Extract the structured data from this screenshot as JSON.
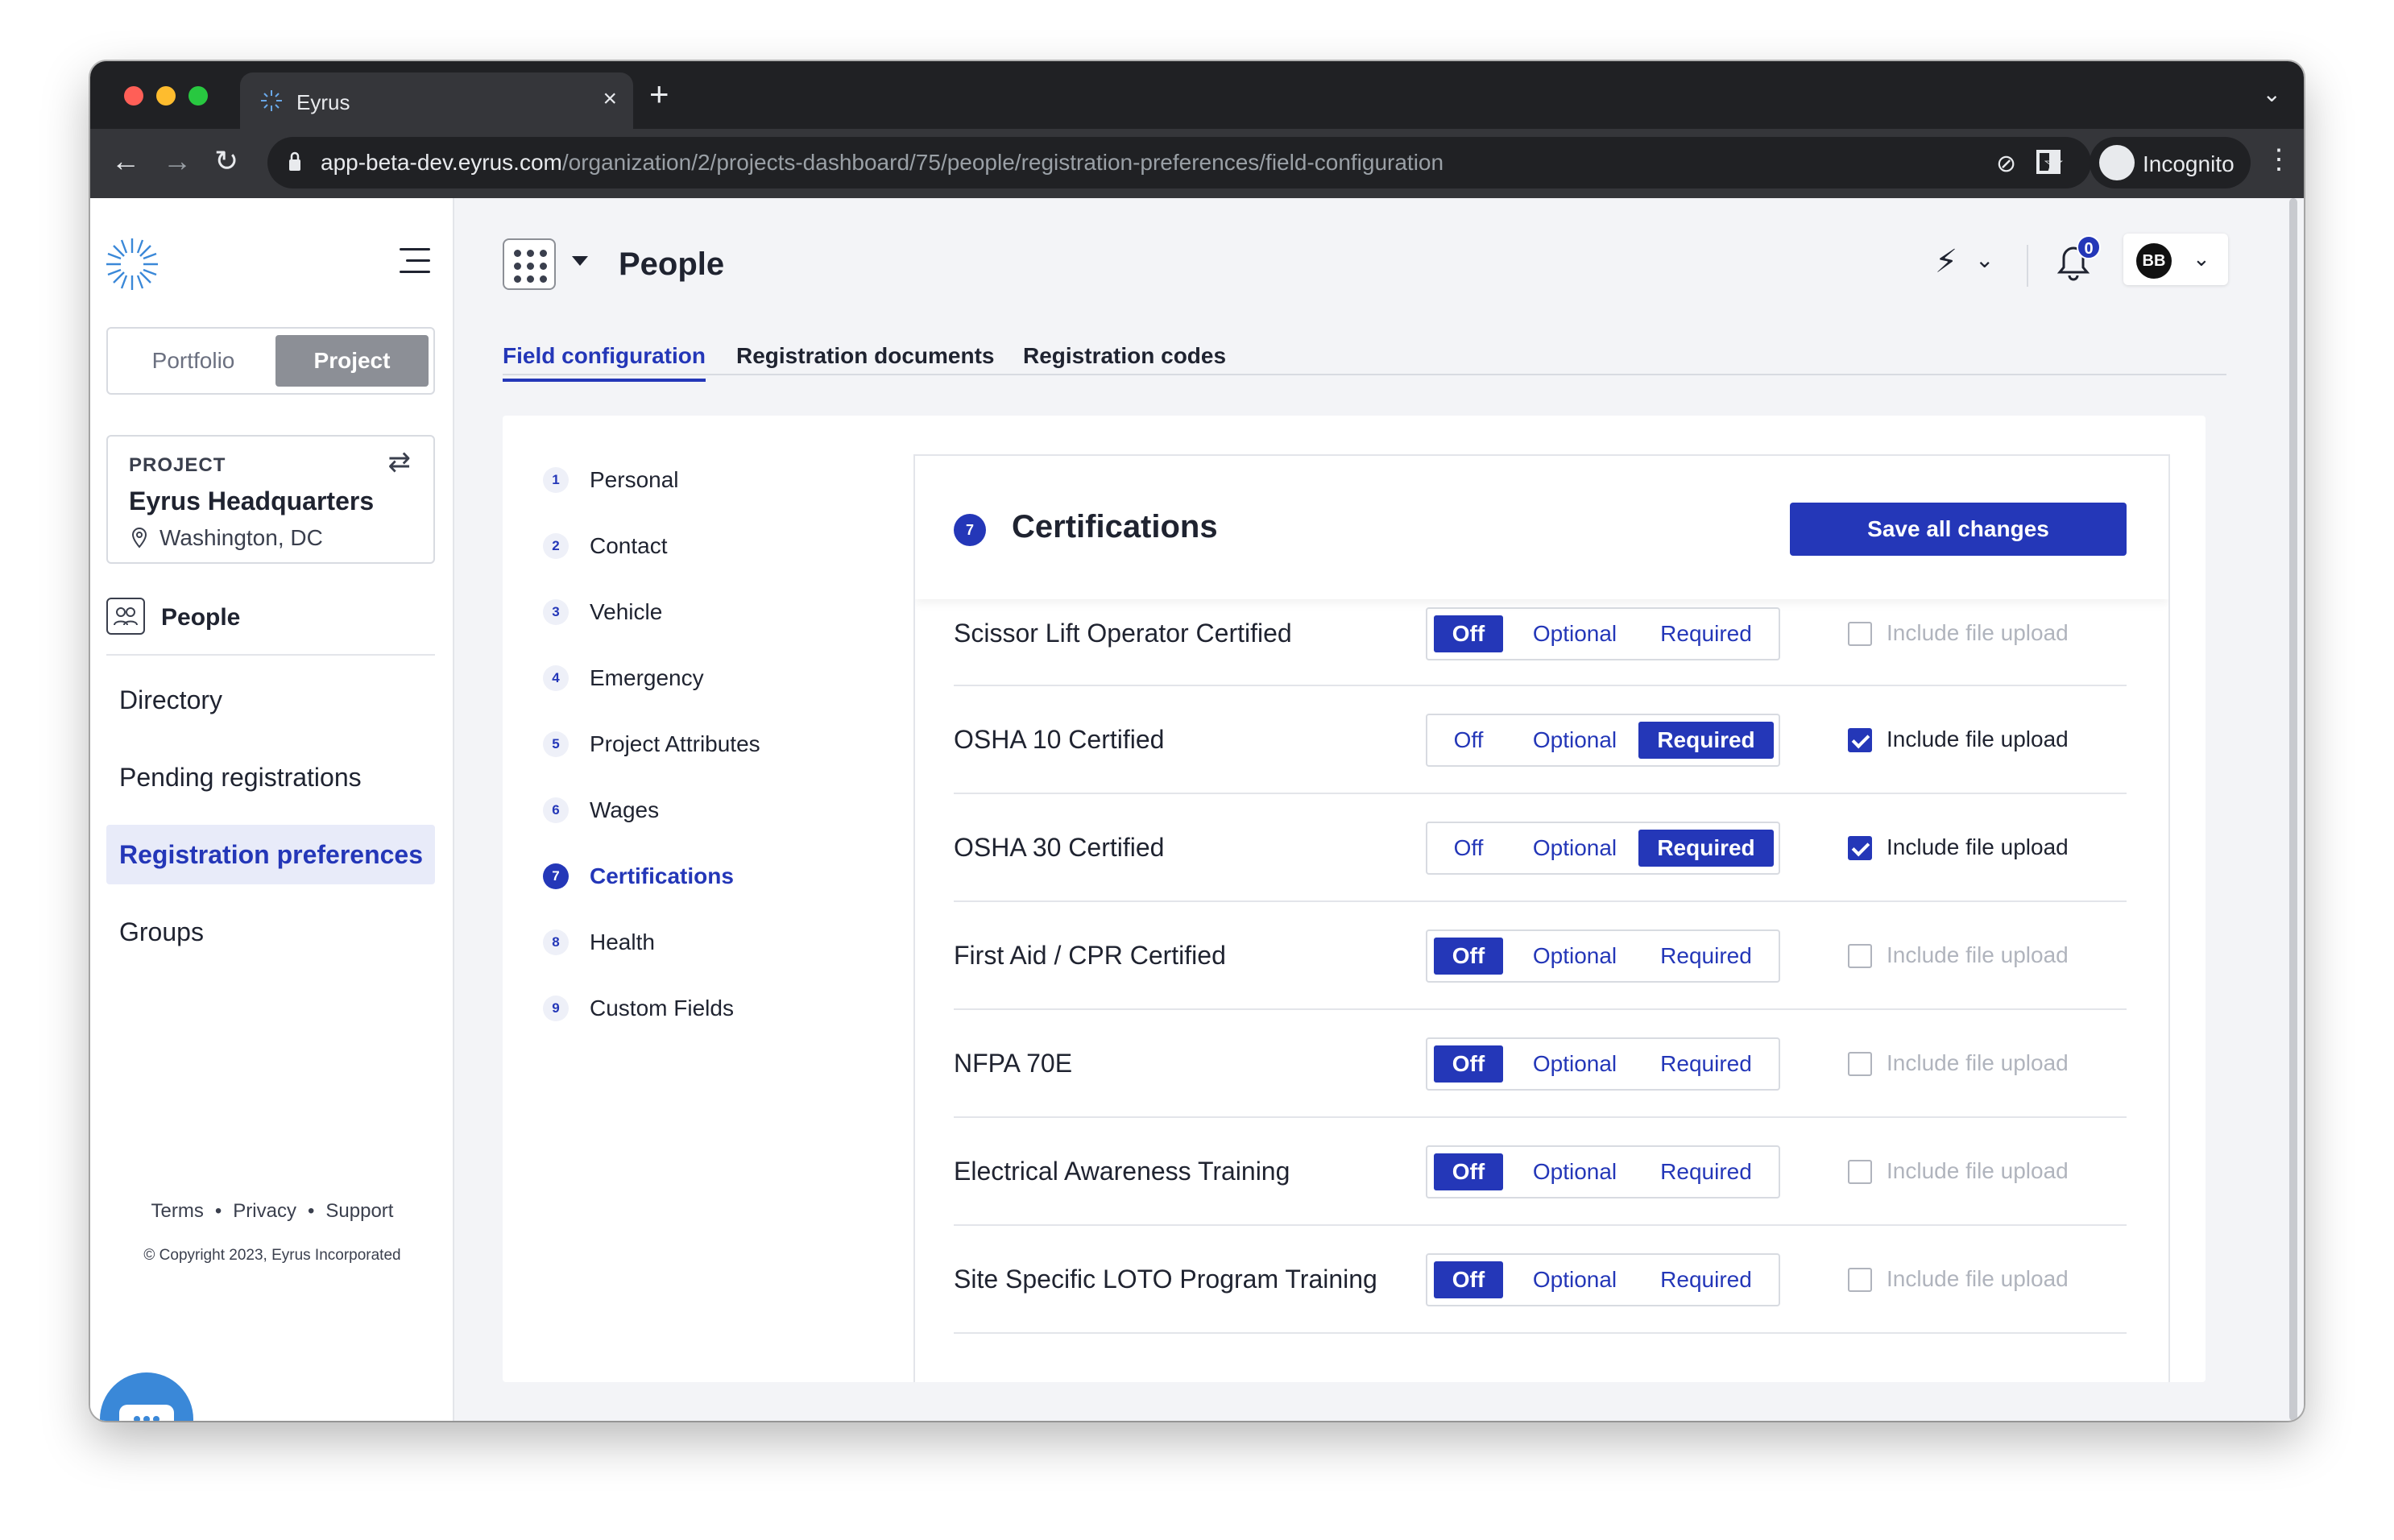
{
  "browser": {
    "tab_title": "Eyrus",
    "url_host": "app-beta-dev.eyrus.com",
    "url_path": "/organization/2/projects-dashboard/75/people/registration-preferences/field-configuration",
    "incognito_label": "Incognito"
  },
  "sidebar": {
    "mode_options": [
      "Portfolio",
      "Project"
    ],
    "selected_mode": "Project",
    "project_tag": "PROJECT",
    "project_name": "Eyrus Headquarters",
    "project_location": "Washington, DC",
    "section_title": "People",
    "nav": [
      {
        "label": "Directory",
        "active": false
      },
      {
        "label": "Pending registrations",
        "active": false
      },
      {
        "label": "Registration preferences",
        "active": true
      },
      {
        "label": "Groups",
        "active": false
      }
    ],
    "footer_links": [
      "Terms",
      "Privacy",
      "Support"
    ],
    "copyright": "© Copyright 2023, Eyrus Incorporated"
  },
  "header": {
    "title": "People",
    "notification_count": "0",
    "user_initials": "BB"
  },
  "tabs": [
    {
      "label": "Field configuration",
      "active": true
    },
    {
      "label": "Registration documents",
      "active": false
    },
    {
      "label": "Registration codes",
      "active": false
    }
  ],
  "steps": [
    {
      "num": "1",
      "label": "Personal"
    },
    {
      "num": "2",
      "label": "Contact"
    },
    {
      "num": "3",
      "label": "Vehicle"
    },
    {
      "num": "4",
      "label": "Emergency"
    },
    {
      "num": "5",
      "label": "Project Attributes"
    },
    {
      "num": "6",
      "label": "Wages"
    },
    {
      "num": "7",
      "label": "Certifications",
      "active": true
    },
    {
      "num": "8",
      "label": "Health"
    },
    {
      "num": "9",
      "label": "Custom Fields"
    }
  ],
  "panel": {
    "num": "7",
    "title": "Certifications",
    "save_label": "Save all changes",
    "toggle_labels": {
      "off": "Off",
      "optional": "Optional",
      "required": "Required"
    },
    "file_upload_label": "Include file upload",
    "fields": [
      {
        "name": "Scissor Lift Operator Certified",
        "setting": "Off",
        "file_upload": false
      },
      {
        "name": "OSHA 10 Certified",
        "setting": "Required",
        "file_upload": true
      },
      {
        "name": "OSHA 30 Certified",
        "setting": "Required",
        "file_upload": true
      },
      {
        "name": "First Aid / CPR Certified",
        "setting": "Off",
        "file_upload": false
      },
      {
        "name": "NFPA 70E",
        "setting": "Off",
        "file_upload": false
      },
      {
        "name": "Electrical Awareness Training",
        "setting": "Off",
        "file_upload": false
      },
      {
        "name": "Site Specific LOTO Program Training",
        "setting": "Off",
        "file_upload": false
      }
    ]
  },
  "colors": {
    "accent": "#2437b8",
    "chat_fab": "#3a88d8"
  }
}
